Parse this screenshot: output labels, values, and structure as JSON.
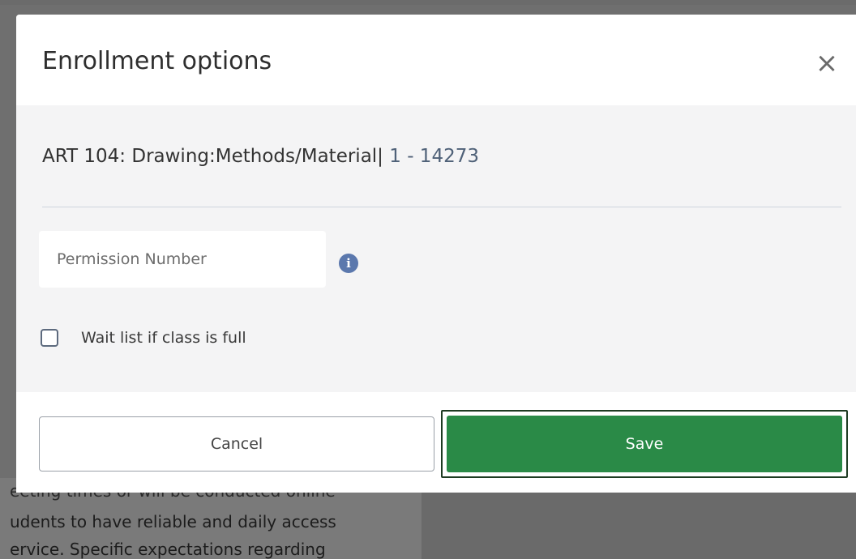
{
  "modal": {
    "title": "Enrollment options",
    "close_label": "×",
    "course": {
      "title": "ART 104: Drawing:Methods/Material|",
      "section": "1 - 14273"
    },
    "permission_input": {
      "placeholder": "Permission Number",
      "value": ""
    },
    "info_icon_glyph": "i",
    "waitlist_label": "Wait list if class is full",
    "waitlist_checked": false,
    "cancel_label": "Cancel",
    "save_label": "Save"
  },
  "background": {
    "text_lines": [
      "eeting times or will be conducted online",
      "udents to have reliable and daily access",
      "ervice. Specific expectations regarding"
    ]
  },
  "colors": {
    "save_green": "#2a8a47",
    "info_blue": "#5b78ad",
    "overlay_gray": "#6f6f6f"
  },
  "icons": {
    "close": "close-icon",
    "info": "info-icon",
    "checkbox": "checkbox-unchecked-icon"
  }
}
